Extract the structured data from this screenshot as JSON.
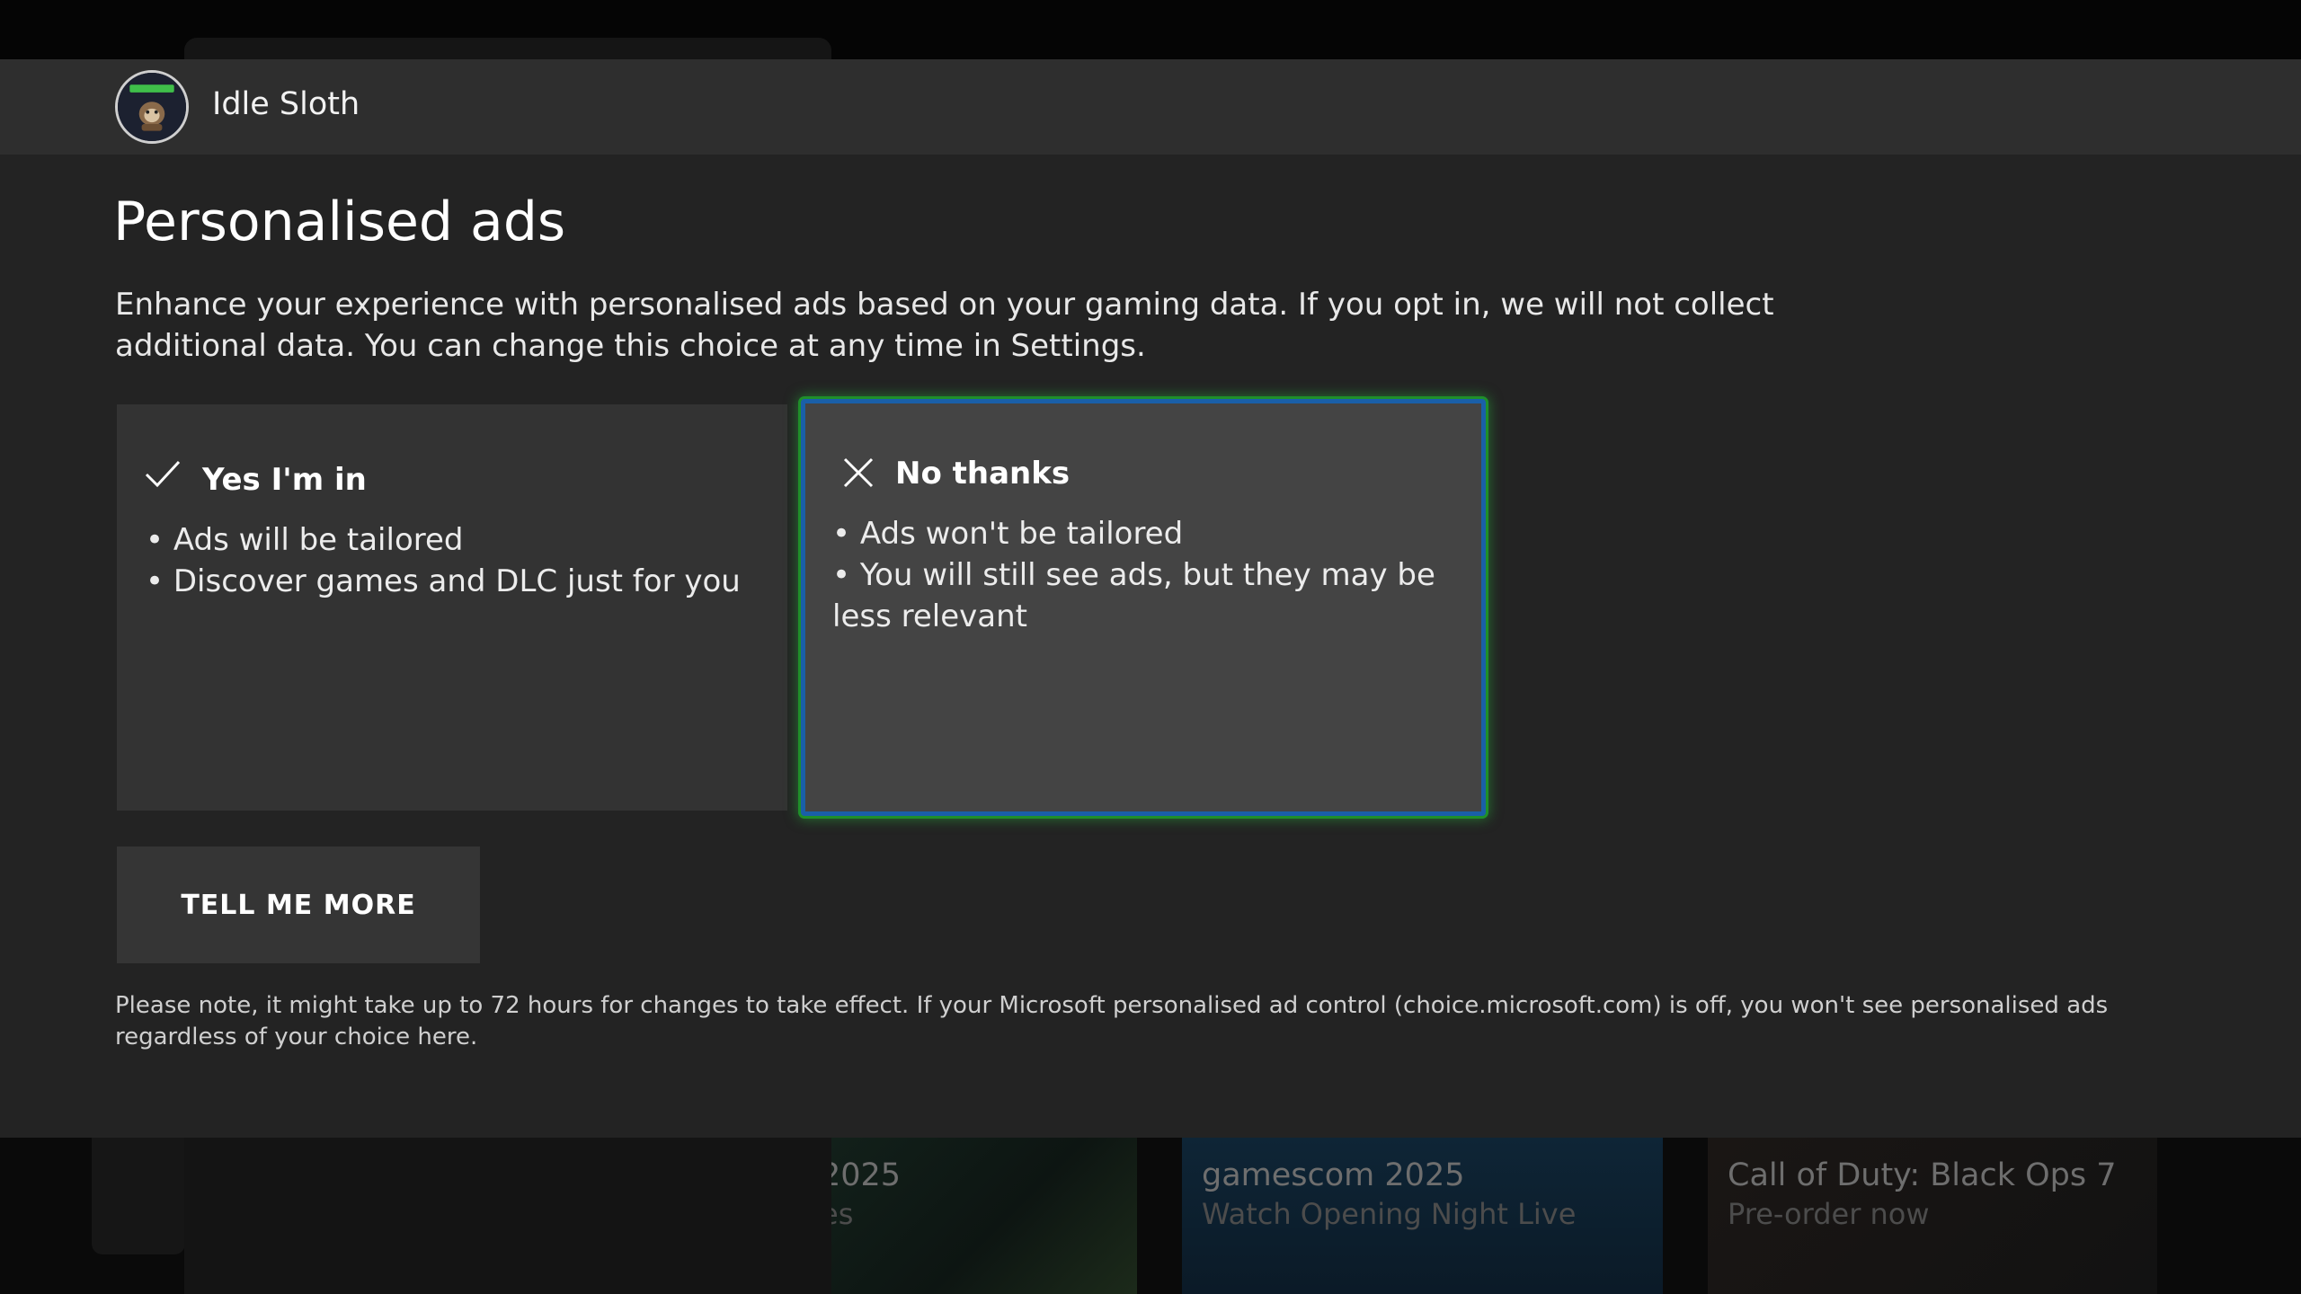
{
  "profile": {
    "gamertag": "Idle Sloth",
    "avatar_icon": "sloth-avatar-icon"
  },
  "dialog": {
    "title": "Personalised ads",
    "description": "Enhance your experience with personalised ads based on your gaming data. If you opt in, we will not collect additional data. You can change this choice at any time in Settings.",
    "options": [
      {
        "icon": "checkmark-icon",
        "label": "Yes I'm in",
        "bullets": [
          "• Ads will be tailored",
          "• Discover games and DLC just for you"
        ],
        "focused": false
      },
      {
        "icon": "close-icon",
        "label": "No thanks",
        "bullets": [
          "• Ads won't be tailored",
          "• You will still see ads, but they may be less relevant"
        ],
        "focused": true
      }
    ],
    "tell_more_label": "TELL ME MORE",
    "note": "Please note, it might take up to 72 hours for changes to take effect. If your Microsoft personalised ad control (choice.microsoft.com) is off, you won't see personalised ads regardless of your choice here."
  },
  "background": {
    "tiles": [
      {
        "title": "2025",
        "subtitle": "es"
      },
      {
        "title": "gamescom 2025",
        "subtitle": "Watch Opening Night Live"
      },
      {
        "title": "Call of Duty: Black Ops 7",
        "subtitle": "Pre-order now"
      }
    ]
  },
  "colors": {
    "dialog_bg": "#232323",
    "header_bg": "#2e2e2e",
    "card_bg": "#333333",
    "card_focused_bg": "#444444",
    "focus_blue": "#1a5fa8",
    "focus_green": "#1f8f2a"
  }
}
